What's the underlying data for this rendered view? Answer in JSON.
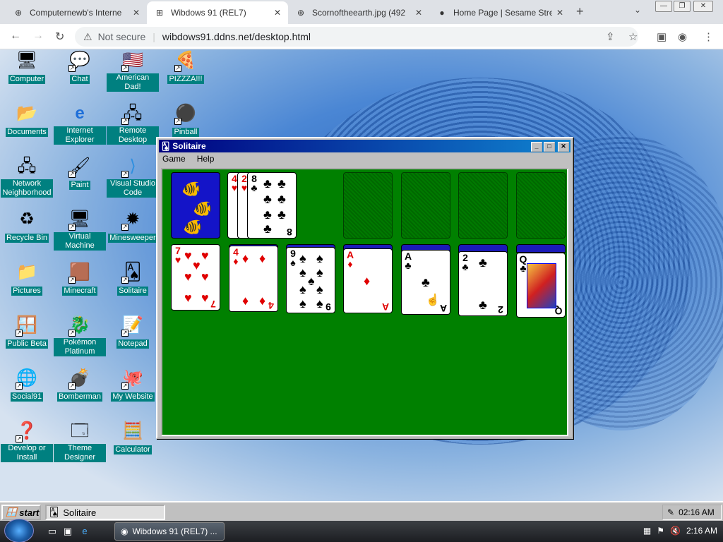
{
  "browser": {
    "tabs": [
      {
        "title": "Computernewb's Interne",
        "favicon": "globe-icon",
        "active": false
      },
      {
        "title": "Wibdows 91 (REL7)",
        "favicon": "windows-icon",
        "active": true
      },
      {
        "title": "Scornoftheearth.jpg (492",
        "favicon": "globe-icon",
        "active": false
      },
      {
        "title": "Home Page | Sesame Stre",
        "favicon": "sesame-icon",
        "active": false
      }
    ],
    "security_label": "Not secure",
    "url": "wibdows91.ddns.net/desktop.html"
  },
  "desktop_icons": [
    {
      "label": "Computer"
    },
    {
      "label": "Chat"
    },
    {
      "label": "American Dad!"
    },
    {
      "label": "PIZZZA!!!"
    },
    {
      "label": "Documents"
    },
    {
      "label": "Internet Explorer"
    },
    {
      "label": "Remote Desktop"
    },
    {
      "label": "Pinball"
    },
    {
      "label": "Network Neighborhood"
    },
    {
      "label": "Paint"
    },
    {
      "label": "Visual Studio Code"
    },
    {
      "label": "Recycle Bin"
    },
    {
      "label": "Virtual Machine"
    },
    {
      "label": "Minesweeper"
    },
    {
      "label": "Pictures"
    },
    {
      "label": "Minecraft"
    },
    {
      "label": "Solitaire"
    },
    {
      "label": "Public Beta"
    },
    {
      "label": "Pokémon Platinum"
    },
    {
      "label": "Notepad"
    },
    {
      "label": "Social91"
    },
    {
      "label": "Bomberman"
    },
    {
      "label": "My Website"
    },
    {
      "label": "Develop or Install"
    },
    {
      "label": "Theme Designer"
    },
    {
      "label": "Calculator"
    }
  ],
  "solitaire": {
    "title": "Solitaire",
    "menu": [
      "Game",
      "Help"
    ],
    "waste": [
      {
        "rank": "4",
        "suit": "♥"
      },
      {
        "rank": "2",
        "suit": "♥"
      },
      {
        "rank": "8",
        "suit": "♣"
      }
    ],
    "tableau": [
      {
        "rank": "7",
        "suit": "♥"
      },
      {
        "rank": "4",
        "suit": "♦"
      },
      {
        "rank": "9",
        "suit": "♠"
      },
      {
        "rank": "A",
        "suit": "♦"
      },
      {
        "rank": "A",
        "suit": "♣"
      },
      {
        "rank": "2",
        "suit": "♣"
      },
      {
        "rank": "Q",
        "suit": "♣"
      }
    ]
  },
  "w9taskbar": {
    "start": "start",
    "app": "Solitaire",
    "time": "02:16 AM"
  },
  "hosttaskbar": {
    "item": "Wibdows 91 (REL7) ...",
    "time": "2:16 AM"
  },
  "colors": {
    "felt": "#008000",
    "title_bar": "#000080",
    "label_bg": "#008080"
  }
}
